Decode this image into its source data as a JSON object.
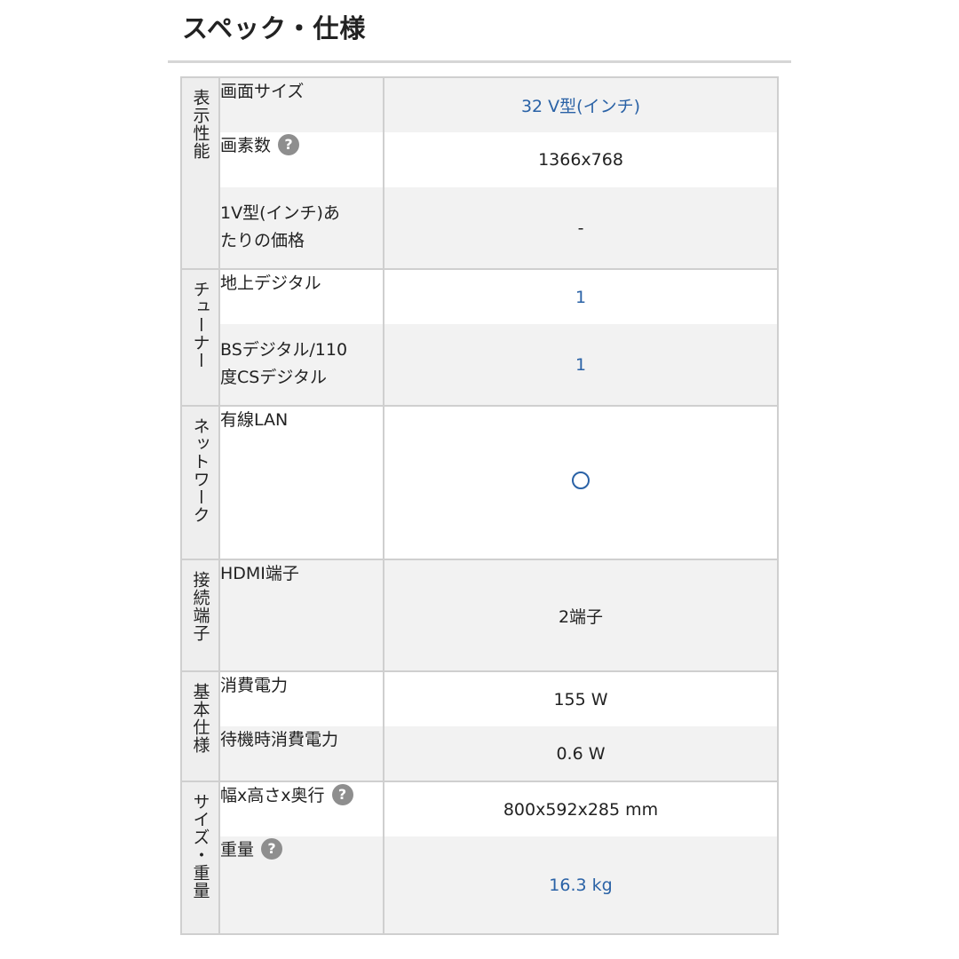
{
  "page": {
    "title": "スペック・仕様"
  },
  "groups": [
    {
      "category": "表示性能",
      "rows": [
        {
          "label": "画面サイズ",
          "value": "32 V型(インチ)",
          "link": true,
          "help": false
        },
        {
          "label": "画素数",
          "value": "1366x768",
          "link": false,
          "help": true
        },
        {
          "label": "1V型(インチ)あ\nたりの価格",
          "value": "-",
          "link": false,
          "help": false
        }
      ]
    },
    {
      "category": "チューナー",
      "rows": [
        {
          "label": "地上デジタル",
          "value": "1",
          "link": true,
          "help": false
        },
        {
          "label": "BSデジタル/110\n度CSデジタル",
          "value": "1",
          "link": true,
          "help": false
        }
      ]
    },
    {
      "category": "ネットワーク",
      "rows": [
        {
          "label": "有線LAN",
          "value": "○",
          "link": true,
          "help": false,
          "icon": "circle-mark-icon"
        }
      ]
    },
    {
      "category": "接続端子",
      "rows": [
        {
          "label": "HDMI端子",
          "value": "2端子",
          "link": false,
          "help": false
        }
      ]
    },
    {
      "category": "基本仕様",
      "rows": [
        {
          "label": "消費電力",
          "value": "155 W",
          "link": false,
          "help": false
        },
        {
          "label": "待機時消費電力",
          "value": "0.6 W",
          "link": false,
          "help": false
        }
      ]
    },
    {
      "category": "サイズ・重量",
      "rows": [
        {
          "label": "幅x高さx奥行",
          "value": "800x592x285 mm",
          "link": false,
          "help": true
        },
        {
          "label": "重量",
          "value": "16.3 kg",
          "link": true,
          "help": true
        }
      ]
    }
  ],
  "help_glyph": "?",
  "colors": {
    "link": "#2a62a6",
    "category_bg": "#eeeeee",
    "stripe_bg": "#f2f2f2",
    "border": "#cfcfcf"
  }
}
